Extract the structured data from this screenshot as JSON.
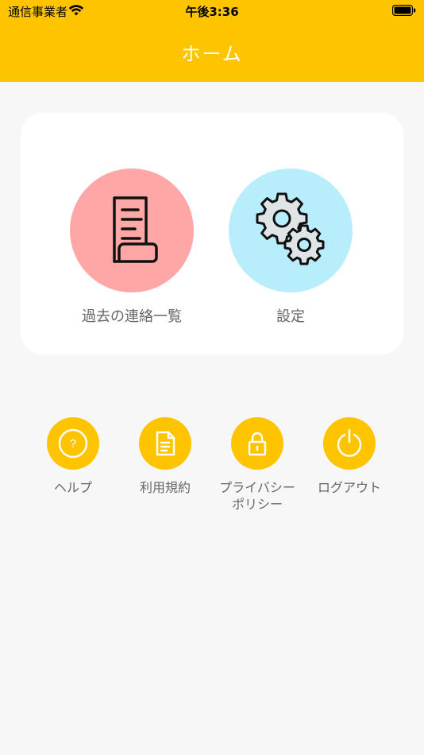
{
  "status_bar": {
    "carrier": "通信事業者",
    "time": "午後3:36"
  },
  "header": {
    "title": "ホーム"
  },
  "main_menu": [
    {
      "label": "過去の連絡一覧",
      "icon": "document-list-icon",
      "color": "#ffa7a7"
    },
    {
      "label": "設定",
      "icon": "gears-icon",
      "color": "#b8eefc"
    }
  ],
  "sub_menu": [
    {
      "label": "ヘルプ",
      "icon": "help-icon"
    },
    {
      "label": "利用規約",
      "icon": "document-icon"
    },
    {
      "label": "プライバシーポリシー",
      "line1": "プライバシー",
      "line2": "ポリシー",
      "icon": "lock-icon"
    },
    {
      "label": "ログアウト",
      "icon": "power-icon"
    }
  ],
  "colors": {
    "accent": "#ffc400",
    "background": "#f7f7f7"
  }
}
